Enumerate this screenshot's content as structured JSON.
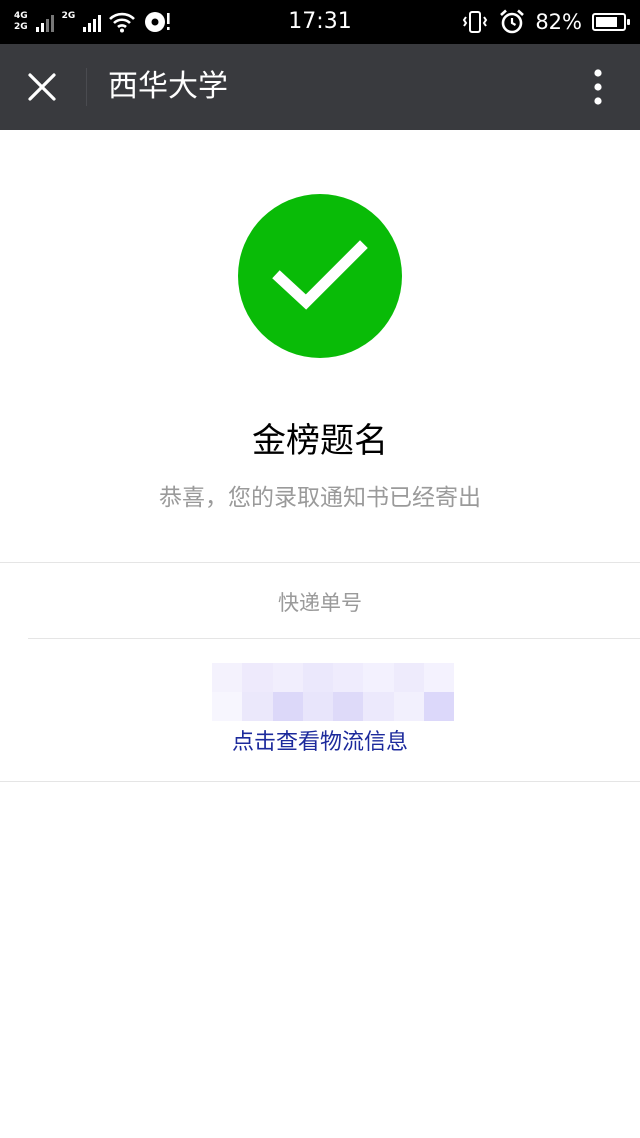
{
  "status_bar": {
    "net_top": "4G",
    "net_bottom": "2G",
    "net_secondary": "2G",
    "time": "17:31",
    "battery_text": "82%",
    "battery_level": 0.82
  },
  "header": {
    "title": "西华大学",
    "close_icon": "close-icon",
    "more_icon": "more-vertical-icon",
    "background": "#393a3e"
  },
  "message": {
    "icon": "check-icon",
    "icon_color": "#09bb07",
    "title": "金榜题名",
    "description": "恭喜，您的录取通知书已经寄出"
  },
  "tracking": {
    "label": "快递单号",
    "link_text": "点击查看物流信息",
    "link_color": "#1c2a9c"
  }
}
